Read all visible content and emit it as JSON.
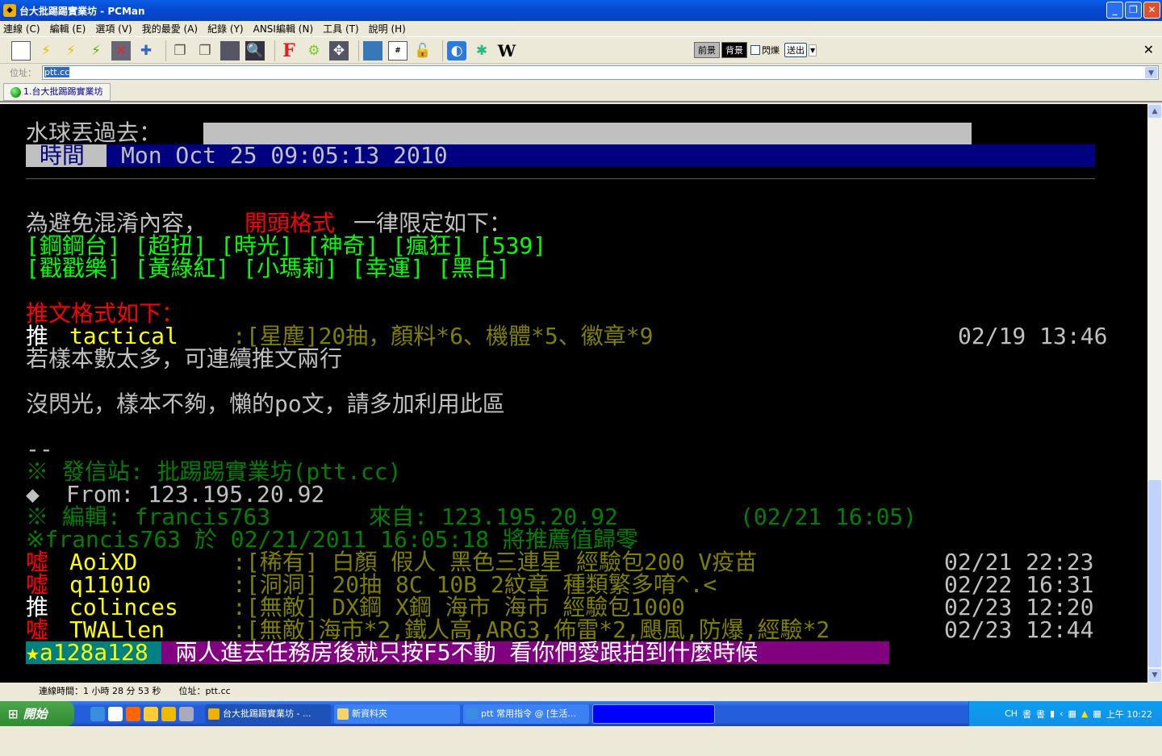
{
  "window": {
    "title": "台大批踢踢實業坊 - PCMan"
  },
  "menu": [
    "連線 (C)",
    "編輯 (E)",
    "選項 (V)",
    "我的最愛 (A)",
    "紀錄 (Y)",
    "ANSI編輯 (N)",
    "工具 (T)",
    "說明 (H)"
  ],
  "toolbar": {
    "icons": [
      "address-book-icon",
      "connect-icon",
      "disconnect-icon",
      "reconnect-icon",
      "close-connection-icon",
      "add-favorite-icon",
      "copy-icon",
      "paste-icon",
      "copy-ansi-icon",
      "search-icon",
      "font-icon",
      "settings-icon",
      "fullscreen-icon",
      "background-icon",
      "ascii-table-icon",
      "lock-icon",
      "pcman-icon",
      "ansi-icon",
      "wikipedia-icon"
    ],
    "font_glyph": "F",
    "wiki_glyph": "W",
    "fg_label": "前景",
    "bg_label": "背景",
    "blink_label": "閃爍",
    "send_label": "送出"
  },
  "address": {
    "label": "位址：",
    "value": "ptt.cc"
  },
  "tab": {
    "label": "1.台大批踢踢實業坊"
  },
  "terminal": {
    "waterball_label": "水球丟過去：",
    "time_label": " 時間 ",
    "time_value": "Mon Oct 25 09:05:13 2010",
    "intro_a": "為避免混淆內容，",
    "intro_b": "開頭格式",
    "intro_c": "一律限定如下：",
    "tags1": "[鋼鋼台] [超扭] [時光] [神奇] [瘋狂] [539]",
    "tags2": "[戳戳樂] [黃綠紅] [小瑪莉] [幸運] [黑白]",
    "push_format": "推文格式如下：",
    "example": {
      "type": "推",
      "user": "tactical",
      "content": ":[星塵]20抽，顏料*6、機體*5、徽章*9",
      "date": "02/19 13:46"
    },
    "multi_line_note": "若樣本數太多，可連續推文兩行",
    "no_flash_note": "沒閃光，樣本不夠，懶的po文，請多加利用此區",
    "sig_sep": "--",
    "origin": "※ 發信站: 批踢踢實業坊(ptt.cc)",
    "from": "From: 123.195.20.92",
    "edit_a": "※ 編輯: francis763",
    "edit_b": "來自: 123.195.20.92",
    "edit_c": "(02/21 16:05)",
    "reset_note": "※francis763 於 02/21/2011 16:05:18 將推薦值歸零",
    "pushes": [
      {
        "type": "噓",
        "user": "AoiXD",
        "content": ":[稀有] 白顏 假人 黑色三連星 經驗包200 V疫苗",
        "date": "02/21 22:23"
      },
      {
        "type": "噓",
        "user": "q11010",
        "content": ":[洞洞] 20抽 8C 10B 2紋章 種類繁多唷^.<",
        "date": "02/22 16:31"
      },
      {
        "type": "推",
        "user": "colinces",
        "content": ":[無敵] DX鋼 X鋼 海市 海市 經驗包1000",
        "date": "02/23 12:20"
      },
      {
        "type": "噓",
        "user": "TWALlen",
        "content": ":[無敵]海市*2,鐵人高,ARG3,佈雷*2,颶風,防爆,經驗*2",
        "date": "02/23 12:44"
      }
    ],
    "input_user": "★a128a128",
    "input_text": " 兩人進去任務房後就只按F5不動 看你們愛跟拍到什麼時候"
  },
  "status": {
    "connected": "連線時間：1 小時 28 分 53 秒",
    "address": "位址：ptt.cc"
  },
  "taskbar": {
    "start": "開始",
    "tasks": [
      "台大批踢踢實業坊 - ...",
      "新資料夾",
      "ptt 常用指令 @ [生活..."
    ],
    "lang": "CH",
    "clock": "上午 10:22"
  },
  "colors": {
    "green": "#00ff00",
    "dkgreen": "#008000",
    "olive": "#808000",
    "yellow": "#ffff00",
    "red": "#ff0000",
    "gray": "#c0c0c0",
    "navy": "#000080",
    "teal": "#008080",
    "purple": "#800080"
  }
}
